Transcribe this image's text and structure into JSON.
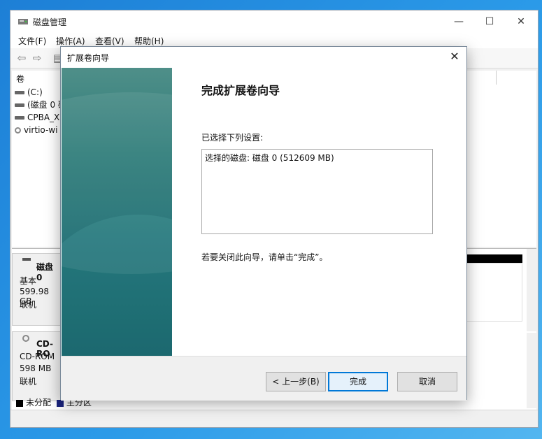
{
  "window": {
    "title": "磁盘管理",
    "controls": {
      "minimize": "—",
      "maximize": "☐",
      "close": "✕"
    }
  },
  "menu": [
    "文件(F)",
    "操作(A)",
    "查看(V)",
    "帮助(H)"
  ],
  "volume_list": {
    "header": "卷",
    "rows": [
      "(C:)",
      "(磁盘 0 磁",
      "CPBA_X6",
      "virtio-wi"
    ]
  },
  "disks": [
    {
      "name": "磁盘 0",
      "type": "基本",
      "size": "599.98 GB",
      "status": "联机"
    },
    {
      "name": "CD-RO",
      "type": "CD-ROM",
      "size": "598 MB",
      "status": "联机"
    }
  ],
  "legend": [
    {
      "label": "未分配",
      "color": "#000000"
    },
    {
      "label": "主分区",
      "color": "#1a237e"
    }
  ],
  "dialog": {
    "title": "扩展卷向导",
    "heading": "完成扩展卷向导",
    "subheading": "已选择下列设置:",
    "settings": "选择的磁盘: 磁盘 0 (512609 MB)",
    "hint": "若要关闭此向导，请单击“完成”。",
    "buttons": {
      "back": "< 上一步(B)",
      "finish": "完成",
      "cancel": "取消"
    },
    "close": "✕"
  }
}
